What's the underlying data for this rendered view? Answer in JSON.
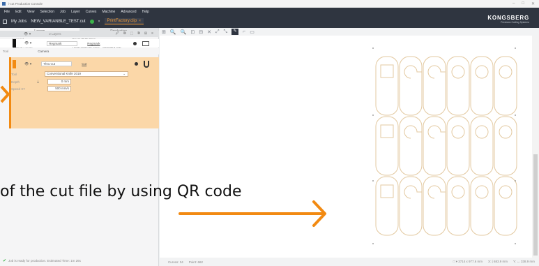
{
  "window": {
    "title": "i-cut Production Console",
    "controls": [
      "–",
      "□",
      "✕"
    ]
  },
  "menu": [
    "File",
    "Edit",
    "View",
    "Selection",
    "Job",
    "Layer",
    "Curves",
    "Machine",
    "Advanced",
    "Help"
  ],
  "tabs": {
    "my_jobs": "My Jobs",
    "job_tab": "NEW_VARIANBLE_TEST.cut",
    "job_tab_close": "×",
    "active_tab": "PrintFactory.clip",
    "active_tab_close": "×"
  },
  "brand": {
    "logo": "KONGSBERG",
    "sub": "Precision Cutting Systems"
  },
  "panel_tabs": [
    "Layers",
    "Production"
  ],
  "properties": [
    {
      "key": "Material",
      "value": "Foam PVC 3mm"
    },
    {
      "key": "Tooling Preset",
      "value": "Rigid Material Knife - Standard Cut"
    }
  ],
  "layers_toolbar": {
    "visibility": "👁 ▾",
    "count": "2 Layers",
    "tools": [
      "🖉",
      "⧉",
      "⬚",
      "⧉",
      "⊞",
      "≡"
    ]
  },
  "layer1": {
    "color": "#111111",
    "eye": "👁 ▾",
    "name": "Regmark",
    "link": "Regmark",
    "tool_label": "Tool",
    "tool_value": "Camera"
  },
  "layer2": {
    "color": "#f28a12",
    "eye": "👁 ▾",
    "name": "Thru-cut",
    "link": "Cut",
    "tool_label": "Tool",
    "tool_value": "Conventional Knife 2019",
    "depth_label": "Depth",
    "depth_value": "0 mm",
    "speed_label": "Speed XY",
    "speed_value": "500 mm/s"
  },
  "status_left": {
    "check": "✔",
    "text": "Job is ready for production. Estimated Time: 1m 26s"
  },
  "canvas_toolbar": [
    "⊞",
    "🔍",
    "🔍",
    "⊡",
    "⊟",
    "✕",
    "⤢",
    "⤡",
    "✎",
    "⌐",
    "▭"
  ],
  "overlay": {
    "hint_text": "of the cut file by using QR code",
    "arrow_color": "#f28a12"
  },
  "statusbar": {
    "left": [
      "Curves: 34",
      "Point: 662"
    ],
    "right": [
      "□ ▾ 3714 x 977.6 mm",
      "X: | 683.9 mm",
      "Y: ↔ 338.9 mm"
    ]
  }
}
